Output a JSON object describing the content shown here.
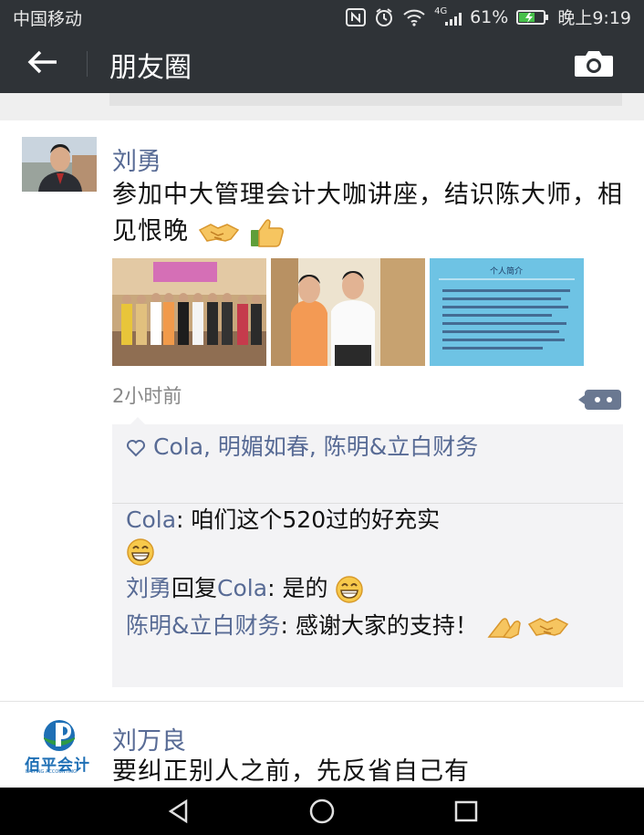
{
  "status_bar": {
    "carrier": "中国移动",
    "network": "4G",
    "battery": "61%",
    "time": "晚上9:19"
  },
  "header": {
    "title": "朋友圈",
    "back_icon": "back-arrow-icon",
    "camera_icon": "camera-icon"
  },
  "posts": [
    {
      "author": "刘勇",
      "text": "参加中大管理会计大咖讲座，结识陈大师，相见恨晚",
      "text_emojis": [
        "handshake-emoji",
        "thumbs-up-emoji"
      ],
      "photos": [
        {
          "subject": "group-photo"
        },
        {
          "subject": "two-people-photo"
        },
        {
          "subject": "profile-card-photo",
          "heading": "个人简介"
        }
      ],
      "time": "2小时前",
      "likes": "Cola, 明媚如春, 陈明&立白财务",
      "comments": [
        {
          "author": "Cola",
          "reply_to": "",
          "text": "咱们这个520过的好充实",
          "emoji": "grin-emoji"
        },
        {
          "author": "刘勇",
          "reply_to": "Cola",
          "reply_word": "回复",
          "text": "是的",
          "emoji": "grin-emoji"
        },
        {
          "author": "陈明&立白财务",
          "reply_to": "",
          "text": "感谢大家的支持！",
          "emoji": "clap-handshake-emoji"
        }
      ]
    },
    {
      "author": "刘万良",
      "avatar_logo_text": "佰平会计",
      "avatar_logo_subtext": "BAIPING ACCOUNTING",
      "text": "要纠正别人之前，先反省自己有"
    }
  ],
  "colors": {
    "header_bg": "#2f3337",
    "name_link": "#586b95",
    "comment_bg": "#f3f3f5"
  }
}
